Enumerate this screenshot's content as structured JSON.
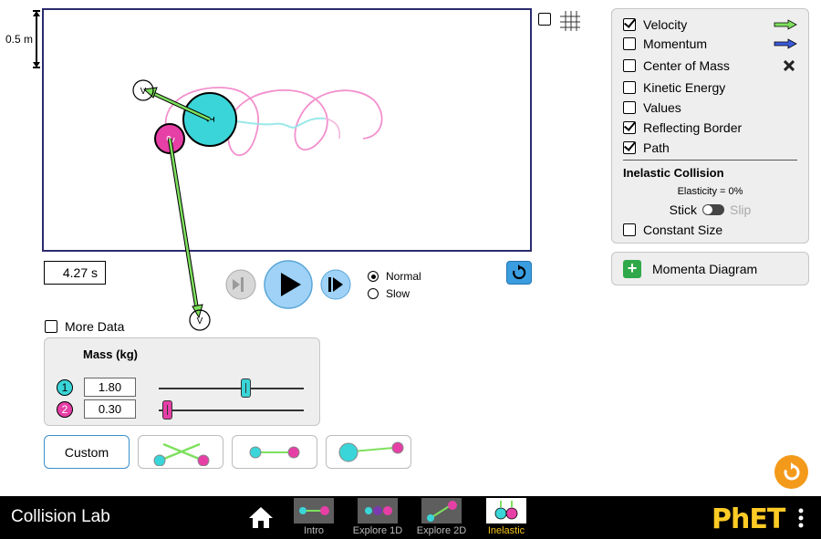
{
  "play_area": {
    "scale_label": "0.5 m",
    "time": "4.27 s"
  },
  "panel": {
    "items": [
      {
        "label": "Velocity",
        "checked": true,
        "icon": "green-arrow-icon"
      },
      {
        "label": "Momentum",
        "checked": false,
        "icon": "blue-arrow-icon"
      },
      {
        "label": "Center of Mass",
        "checked": false,
        "icon": "x-mark-icon"
      },
      {
        "label": "Kinetic Energy",
        "checked": false
      },
      {
        "label": "Values",
        "checked": false
      },
      {
        "label": "Reflecting Border",
        "checked": true
      },
      {
        "label": "Path",
        "checked": true
      }
    ],
    "inelastic_title": "Inelastic Collision",
    "elasticity": "Elasticity = 0%",
    "stick_label": "Stick",
    "slip_label": "Slip",
    "constant_size_label": "Constant Size",
    "constant_size_checked": false
  },
  "momenta": {
    "label": "Momenta Diagram"
  },
  "speed": {
    "normal_label": "Normal",
    "slow_label": "Slow",
    "selected": "Normal"
  },
  "more_data": {
    "label": "More Data",
    "checked": false
  },
  "mass_panel": {
    "title": "Mass (kg)",
    "balls": [
      {
        "number": "1",
        "value": "1.80",
        "color": "#3ad5d8",
        "slider_fraction": 0.6
      },
      {
        "number": "2",
        "value": "0.30",
        "color": "#e63fa6",
        "slider_fraction": 0.06
      }
    ]
  },
  "presets": {
    "custom_label": "Custom"
  },
  "navbar": {
    "app_title": "Collision Lab",
    "tabs": [
      "Intro",
      "Explore 1D",
      "Explore 2D",
      "Inelastic"
    ],
    "active_tab": "Inelastic",
    "logo": "PhET"
  },
  "colors": {
    "ball1": "#3ad5d8",
    "ball2": "#e63fa6",
    "velocity": "#7ee05e",
    "momentum": "#3b5bdb",
    "accent": "#3a9de0"
  }
}
